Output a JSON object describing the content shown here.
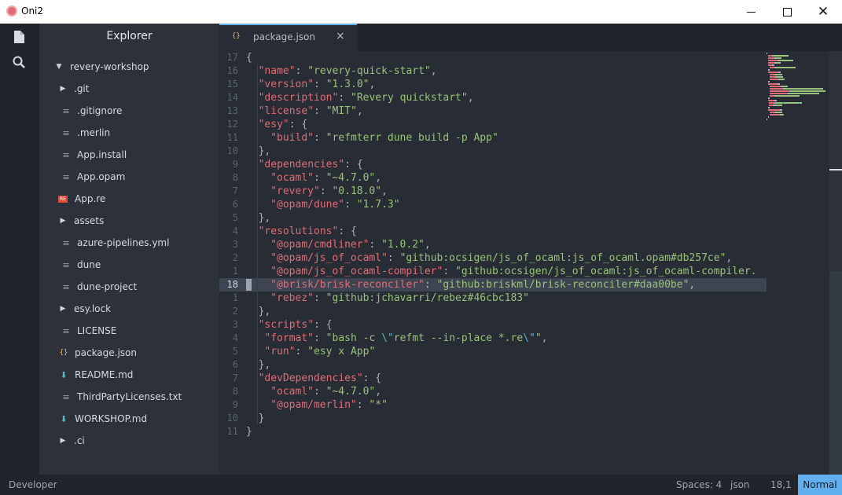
{
  "window": {
    "title": "Oni2",
    "icons": {
      "app": "oni2-app-icon",
      "minimize": "minimize-icon",
      "maximize": "maximize-icon",
      "close": "close-icon"
    }
  },
  "activity_bar": {
    "icons": [
      "file-icon",
      "search-icon"
    ]
  },
  "explorer": {
    "header": "Explorer",
    "items": [
      {
        "label": "revery-workshop",
        "icon": "chevron-down-icon",
        "kind": "root"
      },
      {
        "label": ".git",
        "icon": "chevron-right-icon",
        "kind": "folder"
      },
      {
        "label": ".gitignore",
        "icon": "text-file-icon",
        "kind": "file"
      },
      {
        "label": ".merlin",
        "icon": "text-file-icon",
        "kind": "file"
      },
      {
        "label": "App.install",
        "icon": "text-file-icon",
        "kind": "file"
      },
      {
        "label": "App.opam",
        "icon": "text-file-icon",
        "kind": "file"
      },
      {
        "label": "App.re",
        "icon": "reason-file-icon",
        "kind": "file"
      },
      {
        "label": "assets",
        "icon": "chevron-right-icon",
        "kind": "folder"
      },
      {
        "label": "azure-pipelines.yml",
        "icon": "text-file-icon",
        "kind": "file"
      },
      {
        "label": "dune",
        "icon": "text-file-icon",
        "kind": "file"
      },
      {
        "label": "dune-project",
        "icon": "text-file-icon",
        "kind": "file"
      },
      {
        "label": "esy.lock",
        "icon": "chevron-right-icon",
        "kind": "folder"
      },
      {
        "label": "LICENSE",
        "icon": "text-file-icon",
        "kind": "file"
      },
      {
        "label": "package.json",
        "icon": "json-file-icon",
        "kind": "file"
      },
      {
        "label": "README.md",
        "icon": "markdown-file-icon",
        "kind": "file"
      },
      {
        "label": "ThirdPartyLicenses.txt",
        "icon": "text-file-icon",
        "kind": "file"
      },
      {
        "label": "WORKSHOP.md",
        "icon": "markdown-file-icon",
        "kind": "file"
      },
      {
        "label": ".ci",
        "icon": "chevron-right-icon",
        "kind": "folder"
      }
    ]
  },
  "tabs": [
    {
      "label": "package.json",
      "icon": "json-file-icon",
      "close": "×"
    }
  ],
  "editor": {
    "current_line_index": 17,
    "lines": [
      {
        "num": "17",
        "indent": 0,
        "tokens": [
          [
            "p",
            "{"
          ]
        ]
      },
      {
        "num": "16",
        "indent": 2,
        "tokens": [
          [
            "k",
            "\"name\""
          ],
          [
            "p",
            ": "
          ],
          [
            "s",
            "\"revery-quick-start\""
          ],
          [
            "p",
            ","
          ]
        ]
      },
      {
        "num": "15",
        "indent": 2,
        "tokens": [
          [
            "k",
            "\"version\""
          ],
          [
            "p",
            ": "
          ],
          [
            "s",
            "\"1.3.0\""
          ],
          [
            "p",
            ","
          ]
        ]
      },
      {
        "num": "14",
        "indent": 2,
        "tokens": [
          [
            "k",
            "\"description\""
          ],
          [
            "p",
            ": "
          ],
          [
            "s",
            "\"Revery quickstart\""
          ],
          [
            "p",
            ","
          ]
        ]
      },
      {
        "num": "13",
        "indent": 2,
        "tokens": [
          [
            "k",
            "\"license\""
          ],
          [
            "p",
            ": "
          ],
          [
            "s",
            "\"MIT\""
          ],
          [
            "p",
            ","
          ]
        ]
      },
      {
        "num": "12",
        "indent": 2,
        "tokens": [
          [
            "k",
            "\"esy\""
          ],
          [
            "p",
            ": {"
          ]
        ]
      },
      {
        "num": "11",
        "indent": 4,
        "tokens": [
          [
            "k",
            "\"build\""
          ],
          [
            "p",
            ": "
          ],
          [
            "s",
            "\"refmterr dune build -p App\""
          ]
        ]
      },
      {
        "num": "10",
        "indent": 2,
        "tokens": [
          [
            "p",
            "},"
          ]
        ]
      },
      {
        "num": "9",
        "indent": 2,
        "tokens": [
          [
            "k",
            "\"dependencies\""
          ],
          [
            "p",
            ": {"
          ]
        ]
      },
      {
        "num": "8",
        "indent": 4,
        "tokens": [
          [
            "k",
            "\"ocaml\""
          ],
          [
            "p",
            ": "
          ],
          [
            "s",
            "\"~4.7.0\""
          ],
          [
            "p",
            ","
          ]
        ]
      },
      {
        "num": "7",
        "indent": 4,
        "tokens": [
          [
            "k",
            "\"revery\""
          ],
          [
            "p",
            ": "
          ],
          [
            "s",
            "\"0.18.0\""
          ],
          [
            "p",
            ","
          ]
        ]
      },
      {
        "num": "6",
        "indent": 4,
        "tokens": [
          [
            "k",
            "\"@opam/dune\""
          ],
          [
            "p",
            ": "
          ],
          [
            "s",
            "\"1.7.3\""
          ]
        ]
      },
      {
        "num": "5",
        "indent": 2,
        "tokens": [
          [
            "p",
            "},"
          ]
        ]
      },
      {
        "num": "4",
        "indent": 2,
        "tokens": [
          [
            "k",
            "\"resolutions\""
          ],
          [
            "p",
            ": {"
          ]
        ]
      },
      {
        "num": "3",
        "indent": 4,
        "tokens": [
          [
            "k",
            "\"@opam/cmdliner\""
          ],
          [
            "p",
            ": "
          ],
          [
            "s",
            "\"1.0.2\""
          ],
          [
            "p",
            ","
          ]
        ]
      },
      {
        "num": "2",
        "indent": 4,
        "tokens": [
          [
            "k",
            "\"@opam/js_of_ocaml\""
          ],
          [
            "p",
            ": "
          ],
          [
            "s",
            "\"github:ocsigen/js_of_ocaml:js_of_ocaml.opam#db257ce\""
          ],
          [
            "p",
            ","
          ]
        ]
      },
      {
        "num": "1",
        "indent": 4,
        "tokens": [
          [
            "k",
            "\"@opam/js_of_ocaml-compiler\""
          ],
          [
            "p",
            ": "
          ],
          [
            "s",
            "\"github:ocsigen/js_of_ocaml:js_of_ocaml-compiler."
          ]
        ]
      },
      {
        "num": "18",
        "indent": 4,
        "tokens": [
          [
            "k",
            "\"@brisk/brisk-reconciler\""
          ],
          [
            "p",
            ": "
          ],
          [
            "s",
            "\"github:briskml/brisk-reconciler#daa00be\""
          ],
          [
            "p",
            ","
          ]
        ]
      },
      {
        "num": "1",
        "indent": 4,
        "tokens": [
          [
            "k",
            "\"rebez\""
          ],
          [
            "p",
            ": "
          ],
          [
            "s",
            "\"github:jchavarri/rebez#46cbc183\""
          ]
        ]
      },
      {
        "num": "2",
        "indent": 2,
        "tokens": [
          [
            "p",
            "},"
          ]
        ]
      },
      {
        "num": "3",
        "indent": 2,
        "tokens": [
          [
            "k",
            "\"scripts\""
          ],
          [
            "p",
            ": {"
          ]
        ]
      },
      {
        "num": "4",
        "indent": 3,
        "tokens": [
          [
            "k",
            "\"format\""
          ],
          [
            "p",
            ": "
          ],
          [
            "s",
            "\"bash -c "
          ],
          [
            "esc",
            "\\\""
          ],
          [
            "s",
            "refmt --in-place *.re"
          ],
          [
            "esc",
            "\\\""
          ],
          [
            "s",
            "\""
          ],
          [
            "p",
            ","
          ]
        ]
      },
      {
        "num": "5",
        "indent": 3,
        "tokens": [
          [
            "k",
            "\"run\""
          ],
          [
            "p",
            ": "
          ],
          [
            "s",
            "\"esy x App\""
          ]
        ]
      },
      {
        "num": "6",
        "indent": 2,
        "tokens": [
          [
            "p",
            "},"
          ]
        ]
      },
      {
        "num": "7",
        "indent": 2,
        "tokens": [
          [
            "k",
            "\"devDependencies\""
          ],
          [
            "p",
            ": {"
          ]
        ]
      },
      {
        "num": "8",
        "indent": 4,
        "tokens": [
          [
            "k",
            "\"ocaml\""
          ],
          [
            "p",
            ": "
          ],
          [
            "s",
            "\"~4.7.0\""
          ],
          [
            "p",
            ","
          ]
        ]
      },
      {
        "num": "9",
        "indent": 4,
        "tokens": [
          [
            "k",
            "\"@opam/merlin\""
          ],
          [
            "p",
            ": "
          ],
          [
            "s",
            "\"*\""
          ]
        ]
      },
      {
        "num": "10",
        "indent": 2,
        "tokens": [
          [
            "p",
            "}"
          ]
        ]
      },
      {
        "num": "11",
        "indent": 0,
        "tokens": [
          [
            "p",
            "}"
          ]
        ]
      }
    ]
  },
  "statusbar": {
    "left": "Developer",
    "indent": "Spaces: 4",
    "language": "json",
    "position": "18,1",
    "mode": "Normal"
  },
  "colors": {
    "accent": "#61afef",
    "keyword": "#e06c75",
    "string": "#98c379",
    "escape": "#56b6c2",
    "json_icon": "#e5c07b",
    "reason_icon": "#dd4b39"
  }
}
